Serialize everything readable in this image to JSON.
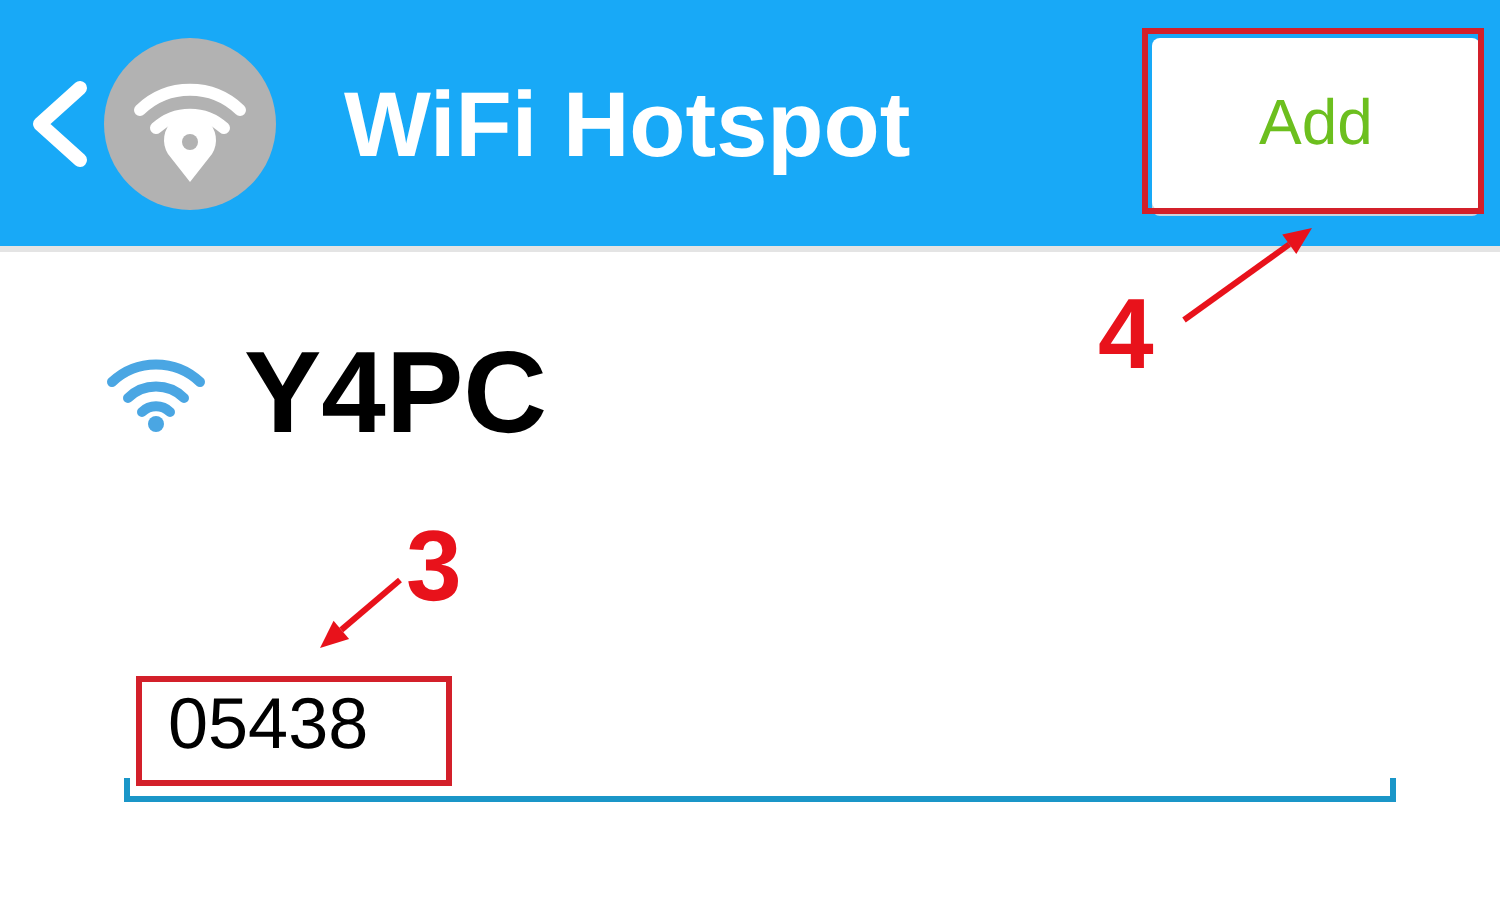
{
  "header": {
    "title": "WiFi Hotspot",
    "action": "Add"
  },
  "network": {
    "name": "Y4PC"
  },
  "password_field": {
    "value": "05438"
  },
  "annotations": [
    {
      "kind": "field",
      "label": "3"
    },
    {
      "kind": "button",
      "label": "4"
    }
  ]
}
